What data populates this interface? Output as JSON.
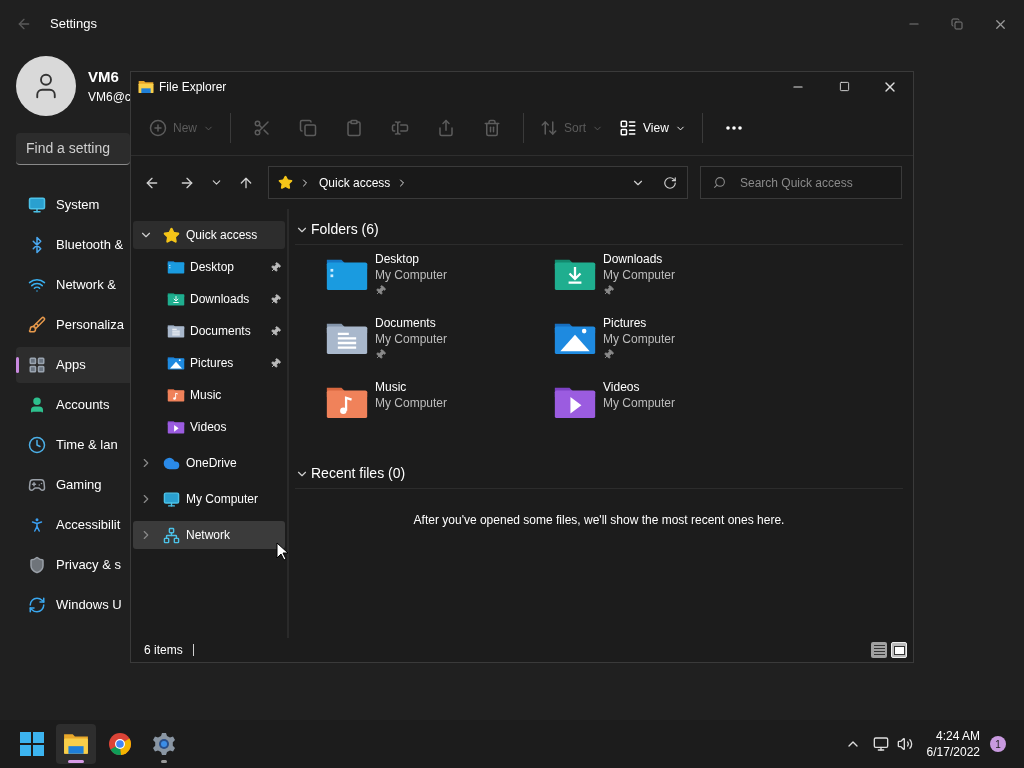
{
  "settings": {
    "title": "Settings",
    "user": {
      "name": "VM6",
      "email": "VM6@c"
    },
    "search": {
      "placeholder": "Find a setting"
    },
    "nav": [
      {
        "kind": "system",
        "label": "System",
        "selected": false
      },
      {
        "kind": "bluetooth",
        "label": "Bluetooth &",
        "selected": false
      },
      {
        "kind": "network",
        "label": "Network &",
        "selected": false
      },
      {
        "kind": "personalization",
        "label": "Personaliza",
        "selected": false
      },
      {
        "kind": "apps",
        "label": "Apps",
        "selected": true
      },
      {
        "kind": "accounts",
        "label": "Accounts",
        "selected": false
      },
      {
        "kind": "time",
        "label": "Time & lan",
        "selected": false
      },
      {
        "kind": "gaming",
        "label": "Gaming",
        "selected": false
      },
      {
        "kind": "accessibility",
        "label": "Accessibilit",
        "selected": false
      },
      {
        "kind": "privacy",
        "label": "Privacy & s",
        "selected": false
      },
      {
        "kind": "update",
        "label": "Windows U",
        "selected": false
      }
    ]
  },
  "explorer": {
    "title": "File Explorer",
    "toolbar": [
      [
        {
          "kind": "new",
          "label": "New",
          "disabled": true
        }
      ],
      [
        {
          "kind": "cut",
          "disabled": true
        },
        {
          "kind": "copy",
          "disabled": true
        },
        {
          "kind": "paste",
          "disabled": true
        },
        {
          "kind": "rename",
          "disabled": true
        },
        {
          "kind": "share",
          "disabled": true
        },
        {
          "kind": "delete",
          "disabled": true
        }
      ],
      [
        {
          "kind": "sort",
          "label": "Sort",
          "disabled": true
        },
        {
          "kind": "view",
          "label": "View",
          "disabled": false
        }
      ],
      [
        {
          "kind": "more",
          "disabled": false
        }
      ]
    ],
    "address": {
      "crumb": "Quick access"
    },
    "search": {
      "placeholder": "Search Quick access"
    },
    "tree": [
      {
        "kind": "quick",
        "label": "Quick access",
        "expanded": true,
        "selected": true,
        "hovered": false,
        "children": [
          {
            "kind": "desktop",
            "label": "Desktop",
            "pinned": true
          },
          {
            "kind": "downloads",
            "label": "Downloads",
            "pinned": true
          },
          {
            "kind": "documents",
            "label": "Documents",
            "pinned": true
          },
          {
            "kind": "pictures",
            "label": "Pictures",
            "pinned": true
          },
          {
            "kind": "music",
            "label": "Music",
            "pinned": false
          },
          {
            "kind": "videos",
            "label": "Videos",
            "pinned": false
          }
        ]
      },
      {
        "kind": "cloud",
        "label": "OneDrive",
        "expanded": false,
        "selected": false,
        "hovered": false
      },
      {
        "kind": "computer",
        "label": "My Computer",
        "expanded": false,
        "selected": false,
        "hovered": false
      },
      {
        "kind": "network",
        "label": "Network",
        "expanded": false,
        "selected": false,
        "hovered": true
      }
    ],
    "folders": {
      "title": "Folders (6)",
      "expanded": true,
      "items": [
        {
          "kind": "desktop",
          "name": "Desktop",
          "location": "My Computer",
          "pinned": true
        },
        {
          "kind": "downloads",
          "name": "Downloads",
          "location": "My Computer",
          "pinned": true
        },
        {
          "kind": "documents",
          "name": "Documents",
          "location": "My Computer",
          "pinned": true
        },
        {
          "kind": "pictures",
          "name": "Pictures",
          "location": "My Computer",
          "pinned": true
        },
        {
          "kind": "music",
          "name": "Music",
          "location": "My Computer",
          "pinned": false
        },
        {
          "kind": "videos",
          "name": "Videos",
          "location": "My Computer",
          "pinned": false
        }
      ]
    },
    "recent": {
      "title": "Recent files (0)",
      "expanded": true,
      "message": "After you've opened some files, we'll show the most recent ones here."
    },
    "status": {
      "count": "6 items",
      "views": [
        {
          "kind": "details",
          "selected": false
        },
        {
          "kind": "tiles",
          "selected": true
        }
      ]
    }
  },
  "taskbar": {
    "apps": [
      {
        "kind": "start",
        "selected": false,
        "running": false
      },
      {
        "kind": "explorer",
        "selected": true,
        "running": true
      },
      {
        "kind": "chrome",
        "selected": false,
        "running": false
      },
      {
        "kind": "settings",
        "selected": false,
        "running": true
      }
    ],
    "time": "4:24 AM",
    "date": "6/17/2022",
    "badge": "1"
  }
}
